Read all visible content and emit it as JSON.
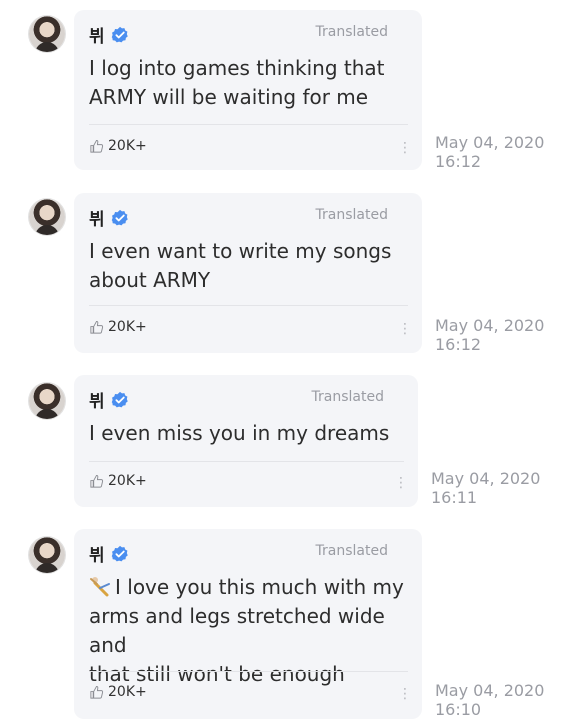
{
  "messages": [
    {
      "author": "뷔",
      "translated_label": "Translated",
      "text": "I log into games thinking that\nARMY will be waiting for me",
      "likes": "20K+",
      "date": "May 04, 2020",
      "time": "16:12",
      "more_icon": "vertical-ellipsis-icon"
    },
    {
      "author": "뷔",
      "translated_label": "Translated",
      "text": "I even want to write my songs\nabout ARMY",
      "likes": "20K+",
      "date": "May 04, 2020",
      "time": "16:12",
      "more_icon": "vertical-ellipsis-icon"
    },
    {
      "author": "뷔",
      "translated_label": "Translated",
      "text": "I even miss you in my dreams",
      "likes": "20K+",
      "date": "May 04, 2020",
      "time": "16:11",
      "more_icon": "vertical-ellipsis-icon"
    },
    {
      "author": "뷔",
      "translated_label": "Translated",
      "text": "I love you this much with my\narms and legs stretched wide and\nthat still won't be enough",
      "likes": "20K+",
      "date": "May 04, 2020",
      "time": "16:10",
      "more_icon": "vertical-ellipsis-icon"
    }
  ],
  "colors": {
    "bubble": "#f4f5f8",
    "verified": "#4a8ef0",
    "muted": "#9a9ca3"
  }
}
